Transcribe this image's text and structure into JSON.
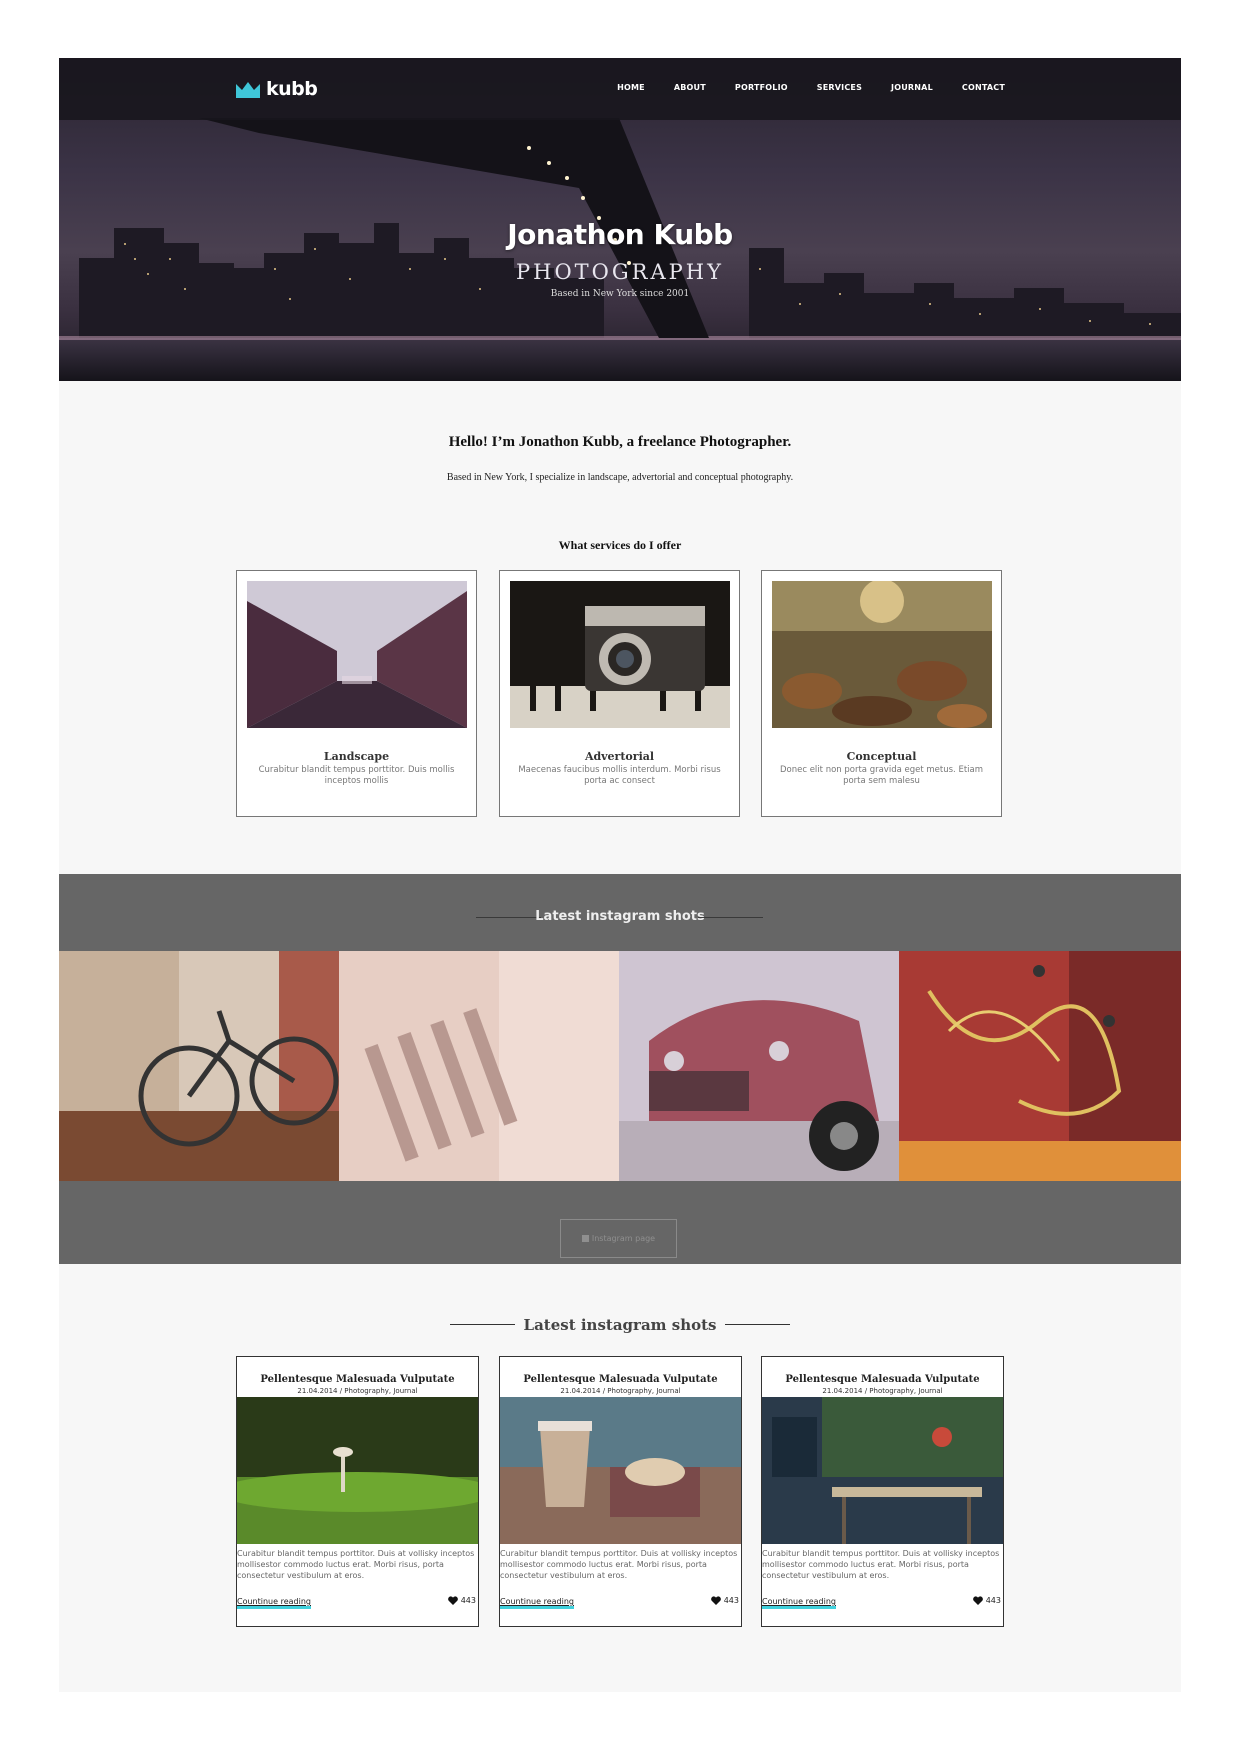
{
  "brand": {
    "name": "kubb",
    "accent": "#3fc6d8"
  },
  "nav": {
    "items": [
      "HOME",
      "ABOUT",
      "PORTFOLIO",
      "SERVICES",
      "JOURNAL",
      "CONTACT"
    ]
  },
  "hero": {
    "title": "Jonathon Kubb",
    "subtitle": "PHOTOGRAPHY",
    "note": "Based in New York since 2001"
  },
  "intro": {
    "title": "Hello! I’m Jonathon Kubb, a freelance Photographer.",
    "text": "Based in New York, I specialize in landscape, advertorial and conceptual photography."
  },
  "services": {
    "title": "What services do I offer",
    "items": [
      {
        "title": "Landscape",
        "desc": "Curabitur blandit tempus porttitor. Duis mollis inceptos mollis"
      },
      {
        "title": "Advertorial",
        "desc": "Maecenas faucibus mollis interdum. Morbi risus porta ac consect"
      },
      {
        "title": "Conceptual",
        "desc": "Donec elit non porta gravida eget metus. Etiam porta sem malesu"
      }
    ]
  },
  "instagram": {
    "title": "Latest instagram shots",
    "button": "Instagram page",
    "shots": [
      "bicycle-photo",
      "clothespins-photo",
      "vintage-truck-photo",
      "rusty-machine-photo"
    ]
  },
  "blog": {
    "title": "Latest instagram shots",
    "posts": [
      {
        "title": "Pellentesque Malesuada Vulputate",
        "meta": "21.04.2014 / Photography, Journal",
        "text": "Curabitur blandit tempus porttitor. Duis at vollisky inceptos mollisestor commodo luctus erat. Morbi risus, porta consectetur vestibulum at eros.",
        "more": "Countinue reading",
        "likes": "443"
      },
      {
        "title": "Pellentesque Malesuada Vulputate",
        "meta": "21.04.2014 / Photography, Journal",
        "text": "Curabitur blandit tempus porttitor. Duis at vollisky inceptos mollisestor commodo luctus erat. Morbi risus, porta consectetur vestibulum at eros.",
        "more": "Countinue reading",
        "likes": "443"
      },
      {
        "title": "Pellentesque Malesuada Vulputate",
        "meta": "21.04.2014 / Photography, Journal",
        "text": "Curabitur blandit tempus porttitor. Duis at vollisky inceptos mollisestor commodo luctus erat. Morbi risus, porta consectetur vestibulum at eros.",
        "more": "Countinue reading",
        "likes": "443"
      }
    ]
  }
}
